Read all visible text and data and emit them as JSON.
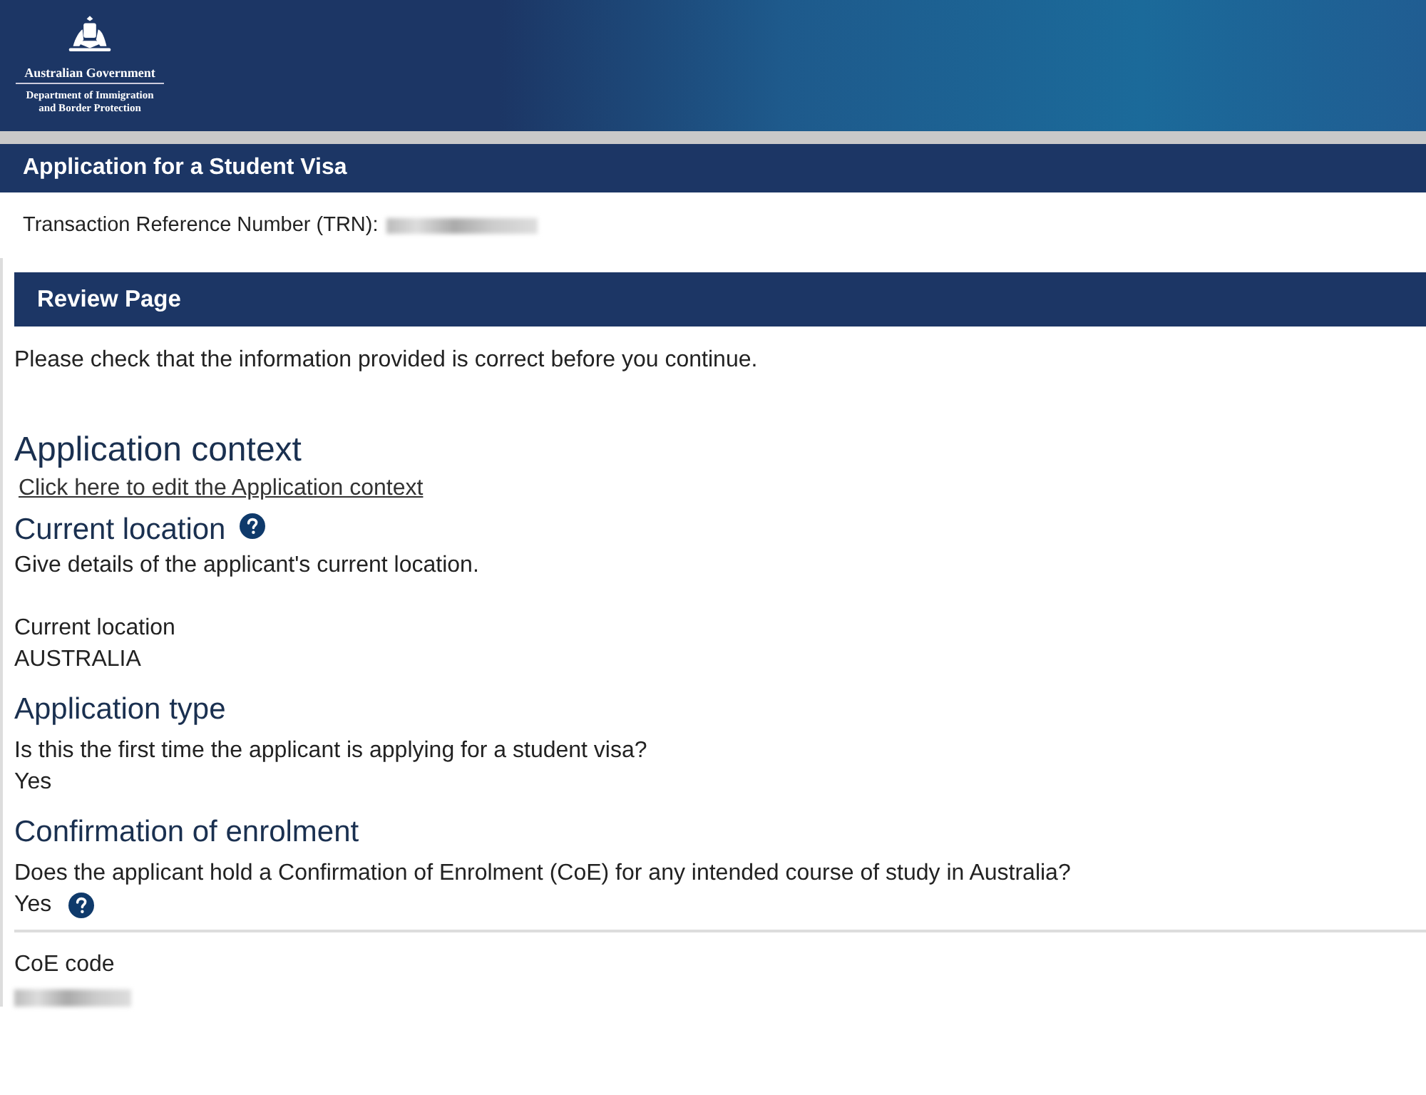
{
  "header": {
    "logo_line_1": "Australian Government",
    "logo_line_2": "Department of Immigration",
    "logo_line_3": "and Border Protection"
  },
  "application_bar": {
    "title": "Application for a Student Visa"
  },
  "trn": {
    "label": "Transaction Reference Number (TRN):"
  },
  "review_bar": {
    "title": "Review Page"
  },
  "intro": "Please check that the information provided is correct before you continue.",
  "sections": [
    {
      "kind": "context",
      "heading": "Application context",
      "link": "Click here to edit the Application context"
    },
    {
      "kind": "question",
      "heading": "Current location",
      "help": true,
      "description": "Give details of the applicant's current location.",
      "fields": [
        {
          "label": "Current location",
          "value": "AUSTRALIA",
          "help": false
        }
      ]
    },
    {
      "kind": "question",
      "heading": "Application type",
      "help": false,
      "fields": [
        {
          "label": "Is this the first time the applicant is applying for a student visa?",
          "value": "Yes",
          "help": false
        }
      ]
    },
    {
      "kind": "question",
      "heading": "Confirmation of enrolment",
      "help": false,
      "fields": [
        {
          "label": "Does the applicant hold a Confirmation of Enrolment (CoE) for any intended course of study in Australia?",
          "value": "Yes",
          "help": true,
          "divider": true
        },
        {
          "label": "CoE code",
          "help": false,
          "redacted": true
        }
      ]
    }
  ]
}
